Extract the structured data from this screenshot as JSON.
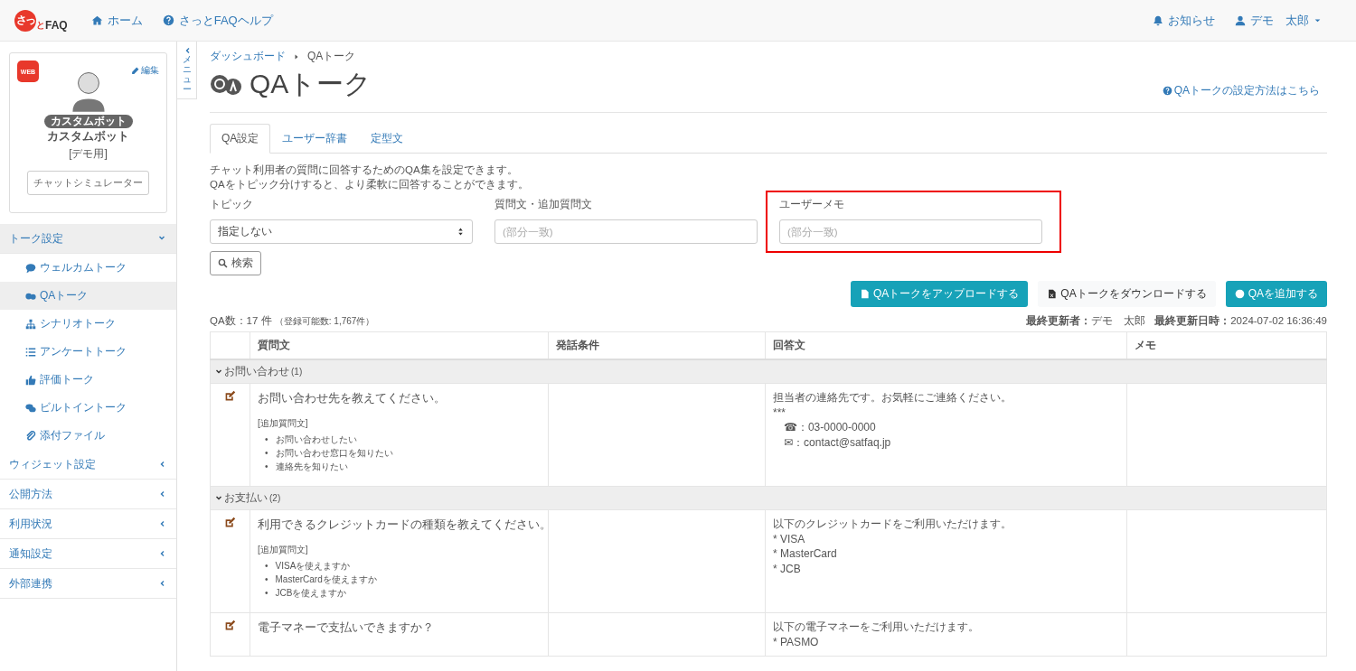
{
  "header": {
    "logo": {
      "mark": "さっ",
      "small": "と",
      "text": "FAQ"
    },
    "nav": [
      {
        "label": "ホーム"
      },
      {
        "label": "さっとFAQヘルプ"
      }
    ],
    "user_menu": [
      {
        "label": "お知らせ",
        "dropdown": false
      },
      {
        "label": "デモ　太郎",
        "dropdown": true
      }
    ]
  },
  "sidebar": {
    "profile": {
      "channel_badge": "WEB",
      "edit": "編集",
      "bot_badge": "カスタムボット",
      "name": "カスタムボット",
      "note": "[デモ用]",
      "button": "チャットシミュレーター"
    },
    "menu": [
      {
        "label": "トーク設定",
        "expanded": true,
        "children": [
          {
            "label": "ウェルカムトーク",
            "selected": false
          },
          {
            "label": "QAトーク",
            "selected": true
          },
          {
            "label": "シナリオトーク",
            "selected": false
          },
          {
            "label": "アンケートトーク",
            "selected": false
          },
          {
            "label": "評価トーク",
            "selected": false
          },
          {
            "label": "ビルトイントーク",
            "selected": false
          },
          {
            "label": "添付ファイル",
            "selected": false
          }
        ]
      },
      {
        "label": "ウィジェット設定",
        "expanded": false
      },
      {
        "label": "公開方法",
        "expanded": false
      },
      {
        "label": "利用状況",
        "expanded": false
      },
      {
        "label": "通知設定",
        "expanded": false
      },
      {
        "label": "外部連携",
        "expanded": false
      }
    ],
    "toggle": "メニュー"
  },
  "breadcrumb": [
    "ダッシュボード",
    "QAトーク"
  ],
  "page_title": "QAトーク",
  "help_link": "QAトークの設定方法はこちら",
  "tabs": [
    {
      "label": "QA設定",
      "selected": true
    },
    {
      "label": "ユーザー辞書",
      "selected": false
    },
    {
      "label": "定型文",
      "selected": false
    }
  ],
  "description": [
    "チャット利用者の質問に回答するためのQA集を設定できます。",
    "QAをトピック分けすると、より柔軟に回答することができます。"
  ],
  "filters": [
    {
      "kind": "select",
      "label": "トピック",
      "value": "指定しない",
      "highlighted": false
    },
    {
      "kind": "text",
      "label": "質問文・追加質問文",
      "placeholder": "(部分一致)",
      "highlighted": false
    },
    {
      "kind": "text",
      "label": "ユーザーメモ",
      "placeholder": "(部分一致)",
      "highlighted": true
    }
  ],
  "search_button": "検索",
  "actions": [
    {
      "kind": "upload",
      "label": "QAトークをアップロードする"
    },
    {
      "kind": "download",
      "label": "QAトークをダウンロードする"
    },
    {
      "kind": "add",
      "label": "QAを追加する"
    }
  ],
  "count": {
    "text": "QA数：17 件",
    "limit": "（登録可能数: 1,767件）"
  },
  "updated": [
    {
      "label": "最終更新者：",
      "value": "デモ　太郎"
    },
    {
      "label": "最終更新日時：",
      "value": "2024-07-02 16:36:49"
    }
  ],
  "table": {
    "columns": [
      "質問文",
      "発話条件",
      "回答文",
      "メモ"
    ],
    "groups": [
      {
        "name": "お問い合わせ",
        "count": "(1)",
        "expanded": true,
        "rows": [
          {
            "question": "お問い合わせ先を教えてください。",
            "extra_label": "[追加質問文]",
            "bullet": "•",
            "extra": [
              "お問い合わせしたい",
              "お問い合わせ窓口を知りたい",
              "連絡先を知りたい"
            ],
            "answer": [
              {
                "text": "担当者の連絡先です。お気軽にご連絡ください。",
                "indented": false
              },
              {
                "text": "***",
                "indented": false
              },
              {
                "text": "☎：03-0000-0000",
                "indented": true
              },
              {
                "text": "✉：contact@satfaq.jp",
                "indented": true
              }
            ]
          }
        ]
      },
      {
        "name": "お支払い",
        "count": "(2)",
        "expanded": true,
        "rows": [
          {
            "question": "利用できるクレジットカードの種類を教えてください。",
            "extra_label": "[追加質問文]",
            "bullet": "•",
            "extra": [
              "VISAを使えますか",
              "MasterCardを使えますか",
              "JCBを使えますか"
            ],
            "answer": [
              {
                "text": "以下のクレジットカードをご利用いただけます。",
                "indented": false
              },
              {
                "text": "* VISA",
                "indented": false
              },
              {
                "text": "* MasterCard",
                "indented": false
              },
              {
                "text": "* JCB",
                "indented": false
              }
            ]
          },
          {
            "question": "電子マネーで支払いできますか？",
            "answer": [
              {
                "text": "以下の電子マネーをご利用いただけます。",
                "indented": false
              },
              {
                "text": "* PASMO",
                "indented": false
              }
            ]
          }
        ]
      }
    ]
  }
}
